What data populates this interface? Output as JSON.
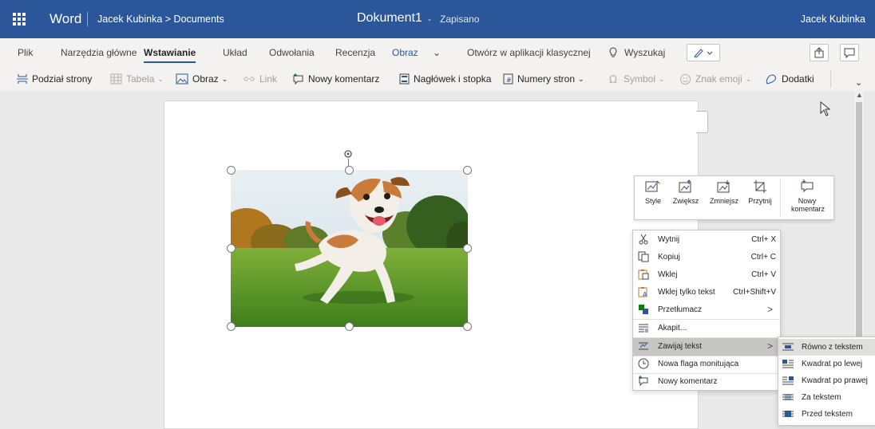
{
  "titlebar": {
    "app_name": "Word",
    "breadcrumb": "Jacek Kubinka > Documents",
    "doc_title": "Dokument1",
    "separator": "-",
    "status": "Zapisano",
    "user": "Jacek Kubinka",
    "bg_color": "#2b579a"
  },
  "ribbon": {
    "tabs": [
      "Plik",
      "Narzędzia główne",
      "Wstawianie",
      "Układ",
      "Odwołania",
      "Recenzja",
      "Obraz",
      "Otwórz w aplikacji klasycznej"
    ],
    "active_tab": "Wstawianie",
    "search_label": "Wyszukaj",
    "chevron": "⌄"
  },
  "toolbar": {
    "page_break": "Podział strony",
    "table": "Tabela",
    "picture": "Obraz",
    "link": "Link",
    "new_comment": "Nowy komentarz",
    "header_footer": "Nagłówek i stopka",
    "page_numbers": "Numery stron",
    "symbol": "Symbol",
    "emoji": "Znak emoji",
    "addins": "Dodatki"
  },
  "minibar": {
    "items": [
      "Style",
      "Zwiększ",
      "Zmniejsz",
      "Przytnij",
      "Nowy komentarz"
    ]
  },
  "context_menu": {
    "items": [
      {
        "label": "Wytnij",
        "shortcut": "Ctrl+ X"
      },
      {
        "label": "Kopiuj",
        "shortcut": "Ctrl+ C"
      },
      {
        "label": "Wklej",
        "shortcut": "Ctrl+ V"
      },
      {
        "label": "Wklej tylko tekst",
        "shortcut": "Ctrl+Shift+V"
      },
      {
        "label": "Przetłumacz",
        "arrow": ">"
      },
      {
        "label": "Akapit..."
      },
      {
        "label": "Zawijaj tekst",
        "arrow": ">"
      },
      {
        "label": "Nowa flaga monitująca"
      },
      {
        "label": "Nowy komentarz"
      }
    ],
    "highlighted": "Zawijaj tekst"
  },
  "wrap_submenu": {
    "items": [
      "Równo z tekstem",
      "Kwadrat po lewej",
      "Kwadrat po prawej",
      "Za tekstem",
      "Przed tekstem"
    ],
    "highlighted": "Równo z tekstem"
  },
  "image": {
    "subject": "dog-running-on-grass-photo"
  }
}
